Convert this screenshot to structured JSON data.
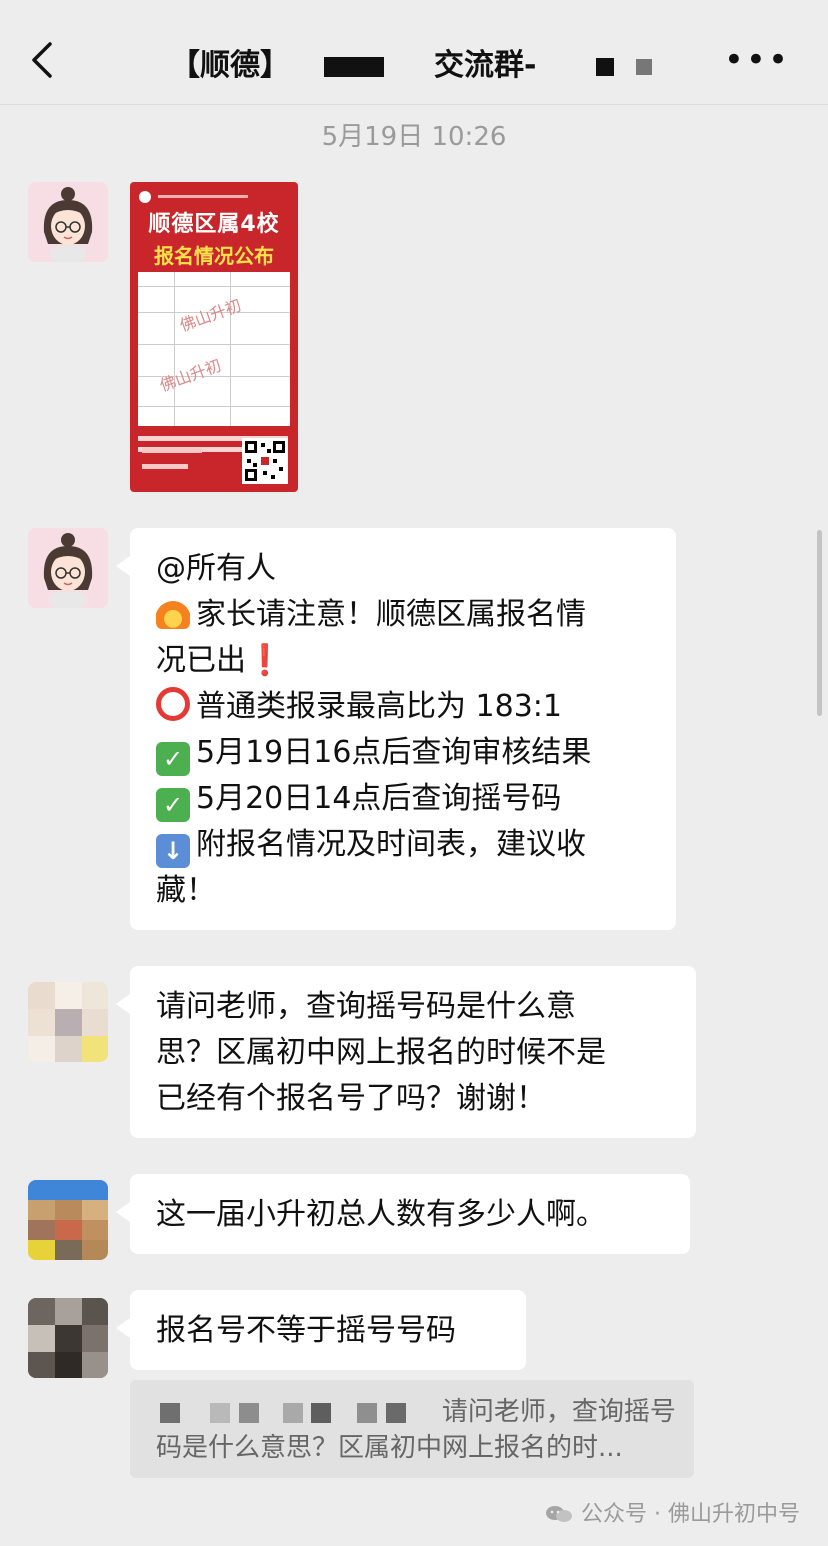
{
  "header": {
    "title_part1": "【顺德】",
    "title_part2": "交流群-"
  },
  "timestamp": "5月19日 10:26",
  "poster": {
    "line1": "顺德区属4校",
    "line2": "报名情况公布",
    "watermark": "佛山升初"
  },
  "messages": [
    {
      "lines": [
        "@所有人",
        "家长请注意！顺德区属报名情",
        "况已出",
        "普通类报录最高比为 183:1",
        "5月19日16点后查询审核结果",
        "5月20日14点后查询摇号码",
        "附报名情况及时间表，建议收",
        "藏！"
      ]
    },
    {
      "lines": [
        "请问老师，查询摇号码是什么意",
        "思？区属初中网上报名的时候不是",
        "已经有个报名号了吗？谢谢！"
      ]
    },
    {
      "lines": [
        "这一届小升初总人数有多少人啊。"
      ]
    },
    {
      "lines": [
        "报名号不等于摇号号码"
      ]
    }
  ],
  "quote": {
    "line1": "请问老师，查询摇号",
    "line2": "码是什么意思？区属初中网上报名的时..."
  },
  "footer": {
    "label": "公众号 · 佛山升初中号"
  }
}
